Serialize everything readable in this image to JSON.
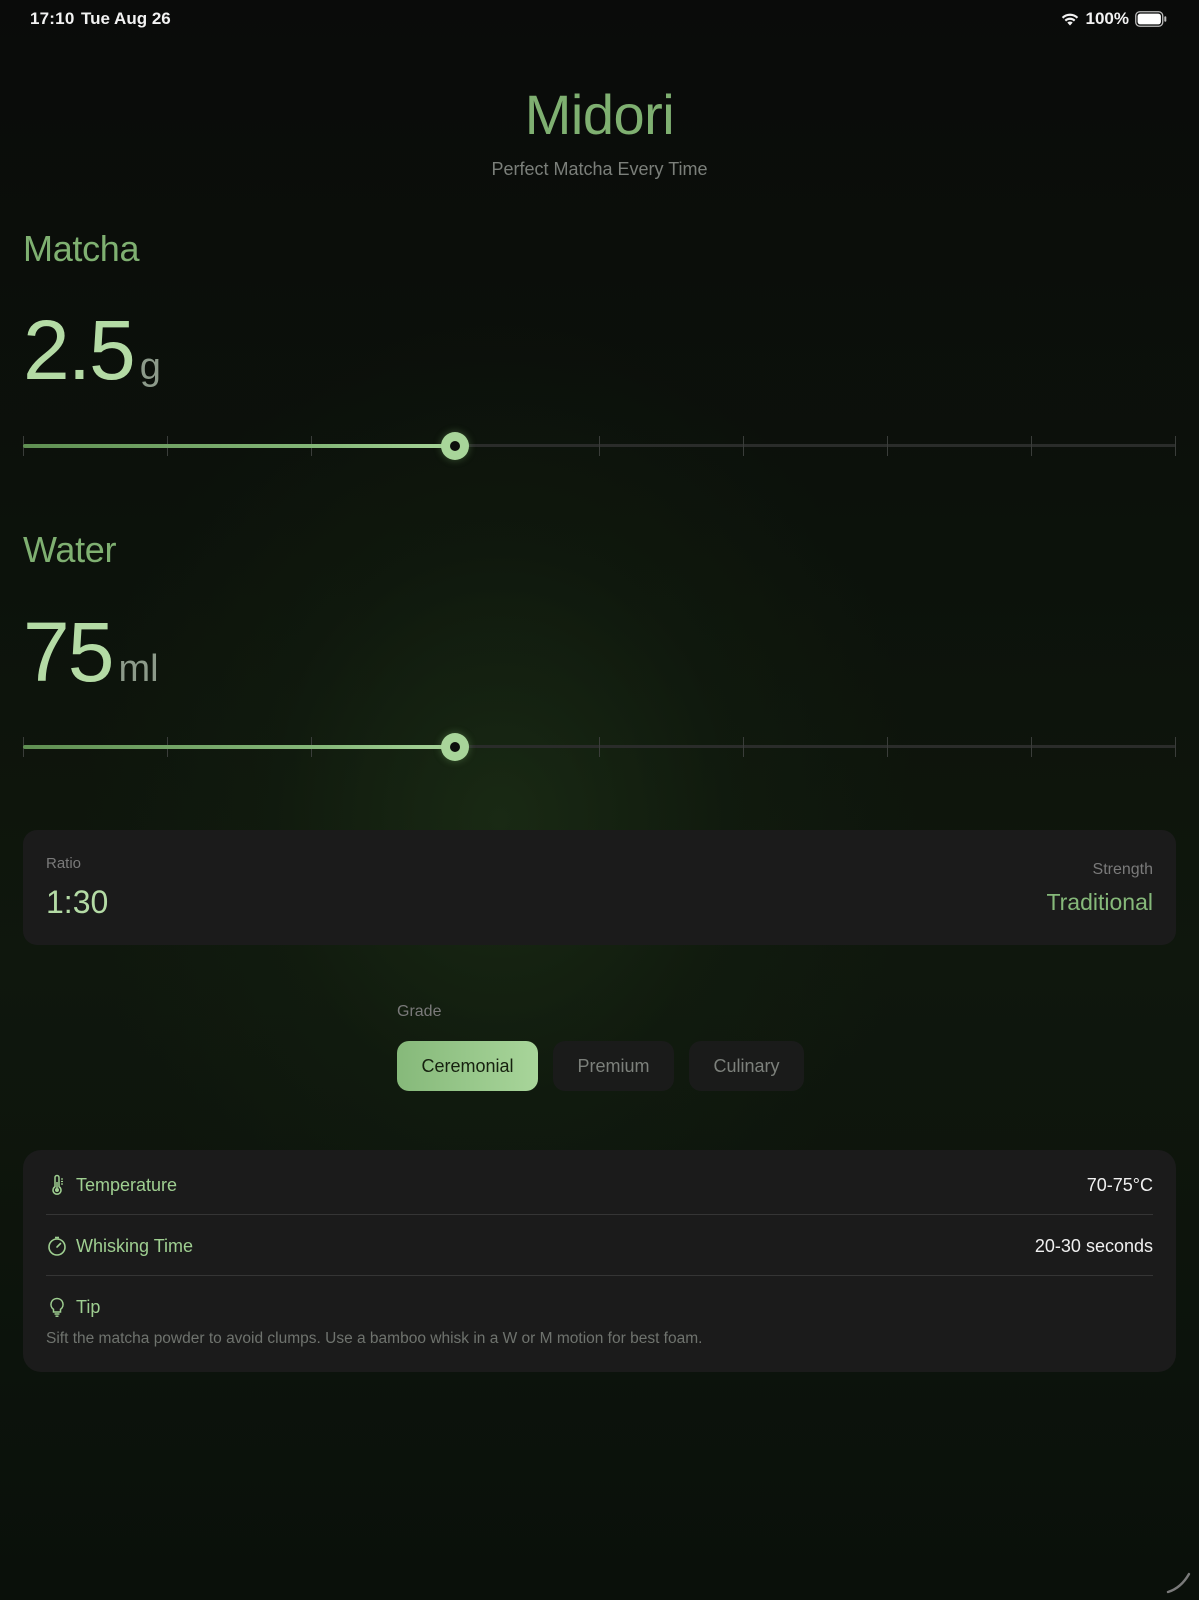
{
  "status_bar": {
    "time": "17:10",
    "date": "Tue Aug 26",
    "battery": "100%"
  },
  "header": {
    "title": "Midori",
    "subtitle": "Perfect Matcha Every Time"
  },
  "matcha": {
    "label": "Matcha",
    "value": "2.5",
    "unit": "g",
    "slider_level": 0.375
  },
  "water": {
    "label": "Water",
    "value": "75",
    "unit": "ml",
    "slider_level": 0.375
  },
  "ratio_card": {
    "ratio_label": "Ratio",
    "ratio_value": "1:30",
    "strength_label": "Strength",
    "strength_value": "Traditional"
  },
  "grade": {
    "label": "Grade",
    "options": [
      "Ceremonial",
      "Premium",
      "Culinary"
    ],
    "selected": "Ceremonial"
  },
  "info": {
    "temperature_label": "Temperature",
    "temperature_value": "70-75°C",
    "whisking_label": "Whisking Time",
    "whisking_value": "20-30 seconds",
    "tip_label": "Tip",
    "tip_text": "Sift the matcha powder to avoid clumps. Use a bamboo whisk in a W or M motion for best foam."
  },
  "colors": {
    "accent": "#86b97a",
    "accent_light": "#a8d59a",
    "card_bg": "#1b1b1b",
    "background": "#0b0f0a"
  },
  "icons": [
    "wifi-icon",
    "battery-icon",
    "thermometer-icon",
    "timer-icon",
    "lightbulb-icon"
  ]
}
